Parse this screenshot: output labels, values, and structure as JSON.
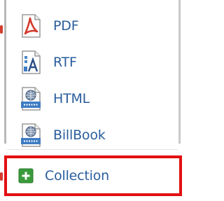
{
  "menu": {
    "items": [
      {
        "label": "PDF",
        "icon": "pdf-file-icon"
      },
      {
        "label": "RTF",
        "icon": "rtf-file-icon"
      },
      {
        "label": "HTML",
        "icon": "html-file-icon"
      },
      {
        "label": "BillBook",
        "icon": "billbook-file-icon"
      }
    ],
    "collection": {
      "label": "Collection",
      "icon": "add-collection-icon"
    }
  },
  "colors": {
    "text": "#2a5d9c",
    "highlight_border": "#e20f12",
    "add_icon_green": "#3a9a3a",
    "pdf_red": "#d33b2f"
  }
}
